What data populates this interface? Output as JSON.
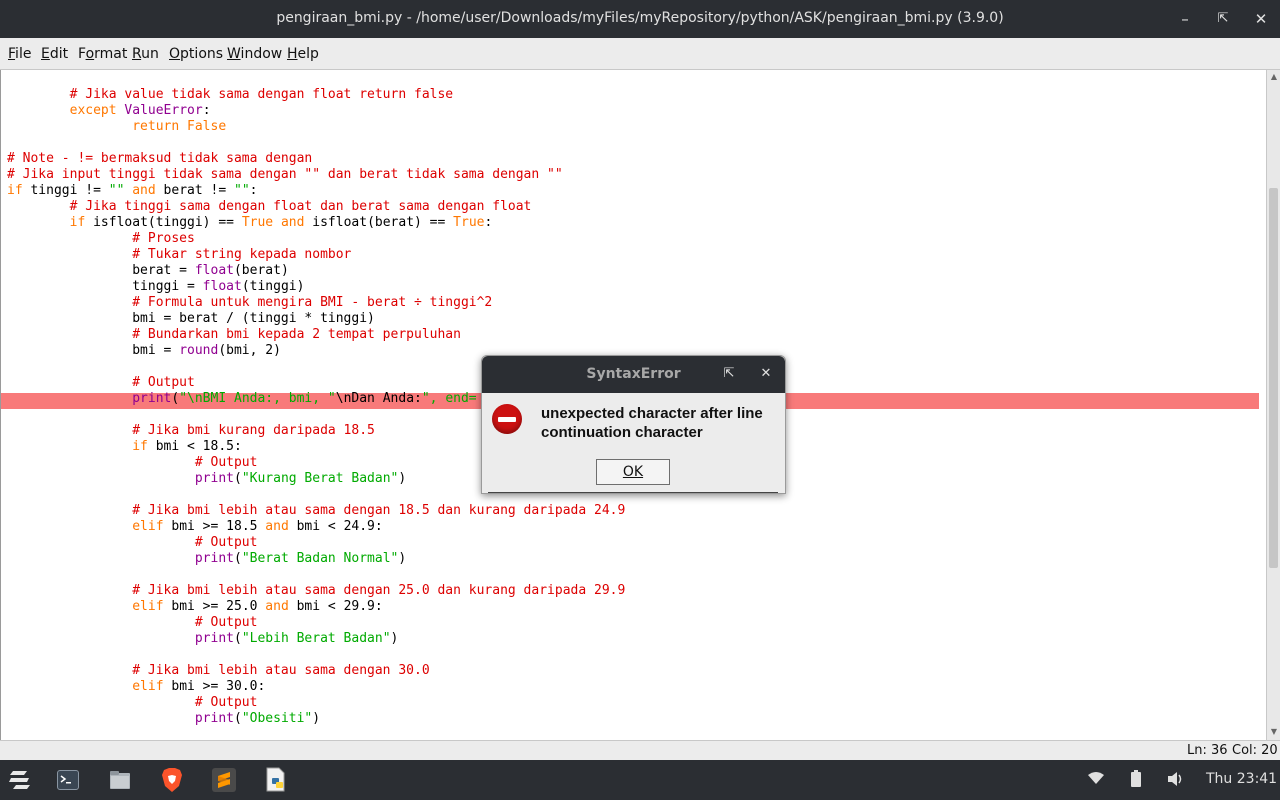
{
  "window": {
    "title": "pengiraan_bmi.py - /home/user/Downloads/myFiles/myRepository/python/ASK/pengiraan_bmi.py (3.9.0)",
    "minimize_icon": "minimize-icon",
    "maximize_icon": "maximize-icon",
    "close_icon": "close-icon"
  },
  "menu": [
    {
      "first": "F",
      "rest": "ile"
    },
    {
      "first": "E",
      "rest": "dit"
    },
    {
      "first": "",
      "rest": "Format",
      "underline_index": 1
    },
    {
      "first": "R",
      "rest": "un"
    },
    {
      "first": "O",
      "rest": "ptions"
    },
    {
      "first": "W",
      "rest": "indow"
    },
    {
      "first": "H",
      "rest": "elp"
    }
  ],
  "menu_labels": [
    "File",
    "Edit",
    "Format",
    "Run",
    "Options",
    "Window",
    "Help"
  ],
  "editor": {
    "highlight_color": "#f87a7a",
    "lines": [
      [
        [
          "c",
          "        # Jika value tidak sama dengan float return false"
        ]
      ],
      [
        [
          "t",
          "        "
        ],
        [
          "k",
          "except"
        ],
        [
          "t",
          " "
        ],
        [
          "b",
          "ValueError"
        ],
        [
          "t",
          ":"
        ]
      ],
      [
        [
          "t",
          "                "
        ],
        [
          "k",
          "return"
        ],
        [
          "t",
          " "
        ],
        [
          "k",
          "False"
        ]
      ],
      [
        [
          "t",
          ""
        ]
      ],
      [
        [
          "c",
          "# Note - != bermaksud tidak sama dengan"
        ]
      ],
      [
        [
          "c",
          "# Jika input tinggi tidak sama dengan \"\" dan berat tidak sama dengan \"\""
        ]
      ],
      [
        [
          "k",
          "if"
        ],
        [
          "t",
          " tinggi != "
        ],
        [
          "s",
          "\"\""
        ],
        [
          "t",
          " "
        ],
        [
          "k",
          "and"
        ],
        [
          "t",
          " berat != "
        ],
        [
          "s",
          "\"\""
        ],
        [
          "t",
          ":"
        ]
      ],
      [
        [
          "c",
          "        # Jika tinggi sama dengan float dan berat sama dengan float"
        ]
      ],
      [
        [
          "t",
          "        "
        ],
        [
          "k",
          "if"
        ],
        [
          "t",
          " isfloat(tinggi) == "
        ],
        [
          "k",
          "True"
        ],
        [
          "t",
          " "
        ],
        [
          "k",
          "and"
        ],
        [
          "t",
          " isfloat(berat) == "
        ],
        [
          "k",
          "True"
        ],
        [
          "t",
          ":"
        ]
      ],
      [
        [
          "c",
          "                # Proses"
        ]
      ],
      [
        [
          "c",
          "                # Tukar string kepada nombor"
        ]
      ],
      [
        [
          "t",
          "                berat = "
        ],
        [
          "b",
          "float"
        ],
        [
          "t",
          "(berat)"
        ]
      ],
      [
        [
          "t",
          "                tinggi = "
        ],
        [
          "b",
          "float"
        ],
        [
          "t",
          "(tinggi)"
        ]
      ],
      [
        [
          "c",
          "                # Formula untuk mengira BMI - berat ÷ tinggi^2"
        ]
      ],
      [
        [
          "t",
          "                bmi = berat / (tinggi * tinggi)"
        ]
      ],
      [
        [
          "c",
          "                # Bundarkan bmi kepada 2 tempat perpuluhan"
        ]
      ],
      [
        [
          "t",
          "                bmi = "
        ],
        [
          "b",
          "round"
        ],
        [
          "t",
          "(bmi, 2)"
        ]
      ],
      [
        [
          "t",
          ""
        ]
      ],
      [
        [
          "c",
          "                # Output"
        ]
      ],
      [
        [
          "t",
          "                "
        ],
        [
          "b",
          "print"
        ],
        [
          "t",
          "("
        ],
        [
          "s",
          "\"\\nBMI Anda:, bmi, \""
        ],
        [
          "t",
          "\\nDan Anda:"
        ],
        [
          "s",
          "\", end="
        ]
      ],
      [
        [
          "t",
          ""
        ]
      ],
      [
        [
          "c",
          "                # Jika bmi kurang daripada 18.5"
        ]
      ],
      [
        [
          "t",
          "                "
        ],
        [
          "k",
          "if"
        ],
        [
          "t",
          " bmi < 18.5:"
        ]
      ],
      [
        [
          "c",
          "                        # Output"
        ]
      ],
      [
        [
          "t",
          "                        "
        ],
        [
          "b",
          "print"
        ],
        [
          "t",
          "("
        ],
        [
          "s",
          "\"Kurang Berat Badan\""
        ],
        [
          "t",
          ")"
        ]
      ],
      [
        [
          "t",
          ""
        ]
      ],
      [
        [
          "c",
          "                # Jika bmi lebih atau sama dengan 18.5 dan kurang daripada 24.9"
        ]
      ],
      [
        [
          "t",
          "                "
        ],
        [
          "k",
          "elif"
        ],
        [
          "t",
          " bmi >= 18.5 "
        ],
        [
          "k",
          "and"
        ],
        [
          "t",
          " bmi < 24.9:"
        ]
      ],
      [
        [
          "c",
          "                        # Output"
        ]
      ],
      [
        [
          "t",
          "                        "
        ],
        [
          "b",
          "print"
        ],
        [
          "t",
          "("
        ],
        [
          "s",
          "\"Berat Badan Normal\""
        ],
        [
          "t",
          ")"
        ]
      ],
      [
        [
          "t",
          ""
        ]
      ],
      [
        [
          "c",
          "                # Jika bmi lebih atau sama dengan 25.0 dan kurang daripada 29.9"
        ]
      ],
      [
        [
          "t",
          "                "
        ],
        [
          "k",
          "elif"
        ],
        [
          "t",
          " bmi >= 25.0 "
        ],
        [
          "k",
          "and"
        ],
        [
          "t",
          " bmi < 29.9:"
        ]
      ],
      [
        [
          "c",
          "                        # Output"
        ]
      ],
      [
        [
          "t",
          "                        "
        ],
        [
          "b",
          "print"
        ],
        [
          "t",
          "("
        ],
        [
          "s",
          "\"Lebih Berat Badan\""
        ],
        [
          "t",
          ")"
        ]
      ],
      [
        [
          "t",
          ""
        ]
      ],
      [
        [
          "c",
          "                # Jika bmi lebih atau sama dengan 30.0"
        ]
      ],
      [
        [
          "t",
          "                "
        ],
        [
          "k",
          "elif"
        ],
        [
          "t",
          " bmi >= 30.0:"
        ]
      ],
      [
        [
          "c",
          "                        # Output"
        ]
      ],
      [
        [
          "t",
          "                        "
        ],
        [
          "b",
          "print"
        ],
        [
          "t",
          "("
        ],
        [
          "s",
          "\"Obesiti\""
        ],
        [
          "t",
          ")"
        ]
      ]
    ]
  },
  "status": {
    "line": "Ln: 36",
    "col": "Col: 20"
  },
  "dialog": {
    "title": "SyntaxError",
    "message": "unexpected character after line continuation character",
    "ok_label": "OK",
    "icon": "error-icon"
  },
  "taskbar": {
    "clock": "Thu 23:41",
    "apps": [
      "zorin-menu-icon",
      "terminal-icon",
      "files-icon",
      "brave-browser-icon",
      "sublime-text-icon",
      "python-idle-icon"
    ],
    "tray": [
      "wifi-icon",
      "battery-icon",
      "volume-icon"
    ]
  }
}
